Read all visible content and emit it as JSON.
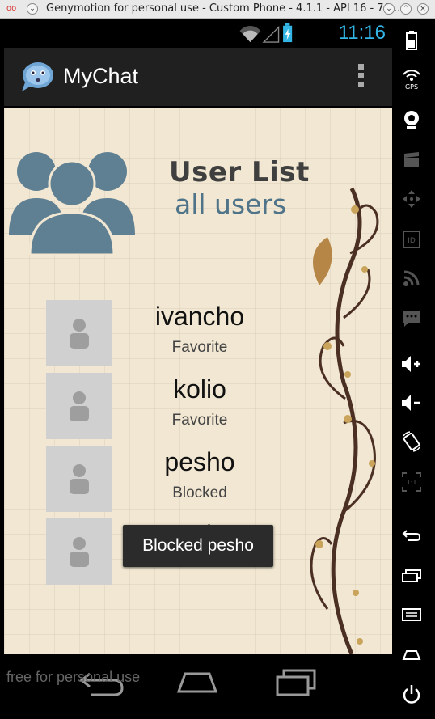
{
  "window": {
    "title": "Genymotion for personal use - Custom Phone - 4.1.1 - API 16 - 76...",
    "logo": "oo",
    "buttons": [
      "minimize",
      "maximize",
      "close"
    ]
  },
  "status_bar": {
    "time": "11:16"
  },
  "action_bar": {
    "title": "MyChat"
  },
  "header": {
    "title": "User List",
    "subtitle": "all users"
  },
  "users": [
    {
      "name": "ivancho",
      "status": "Favorite"
    },
    {
      "name": "kolio",
      "status": "Favorite"
    },
    {
      "name": "pesho",
      "status": "Blocked"
    },
    {
      "name": "vasko",
      "status": ""
    }
  ],
  "toast": {
    "message": "Blocked pesho"
  },
  "watermark": "free for personal use",
  "side_panel": {
    "gps_label": "GPS",
    "id_label": "ID",
    "scale_label": "1:1",
    "icons": [
      "battery-icon",
      "gps-icon",
      "camera-icon",
      "clapper-icon",
      "dpad-icon",
      "id-icon",
      "rss-icon",
      "sms-icon",
      "volume-up-icon",
      "volume-down-icon",
      "rotate-icon",
      "scale-icon",
      "back-icon",
      "recent-apps-icon",
      "menu-icon",
      "home-icon",
      "power-icon"
    ]
  },
  "colors": {
    "accent": "#33b5e5",
    "action_bar": "#202020",
    "toast": "#2b2b2b",
    "header_title": "#3f3f3f",
    "header_sub": "#4f7489",
    "avatar_bg": "#d0d0d0"
  }
}
